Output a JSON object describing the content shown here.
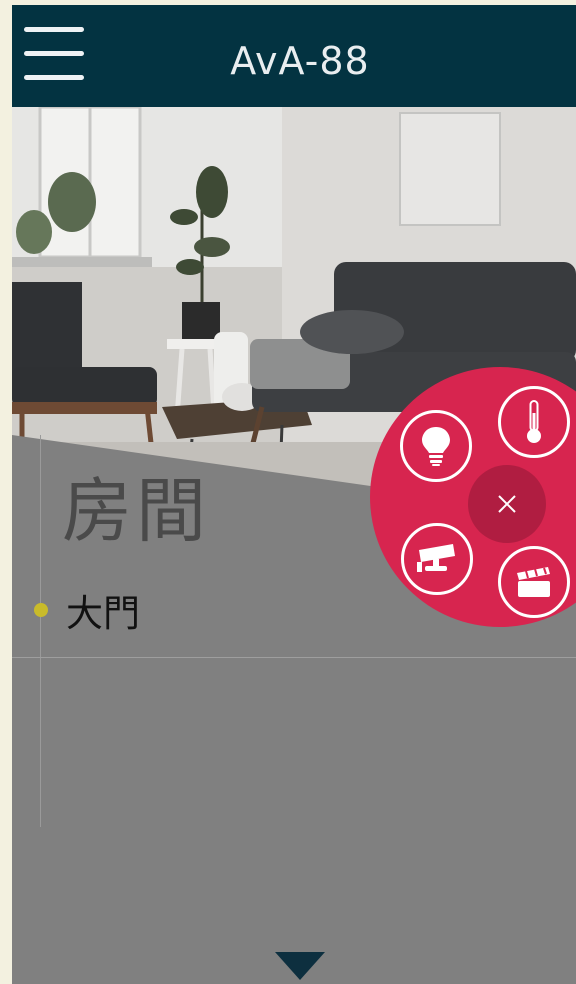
{
  "header": {
    "title": "AvA-88",
    "menu_icon": "hamburger-icon"
  },
  "room": {
    "title": "房間",
    "items": [
      {
        "label": "大門"
      }
    ]
  },
  "fab_menu": {
    "accent_color": "#d7254f",
    "items": [
      {
        "icon": "light-bulb-icon"
      },
      {
        "icon": "thermometer-icon"
      },
      {
        "icon": "security-camera-icon"
      },
      {
        "icon": "clapperboard-icon"
      }
    ],
    "close_icon": "close-icon"
  },
  "footer": {
    "scroll_icon": "chevron-down-icon"
  }
}
